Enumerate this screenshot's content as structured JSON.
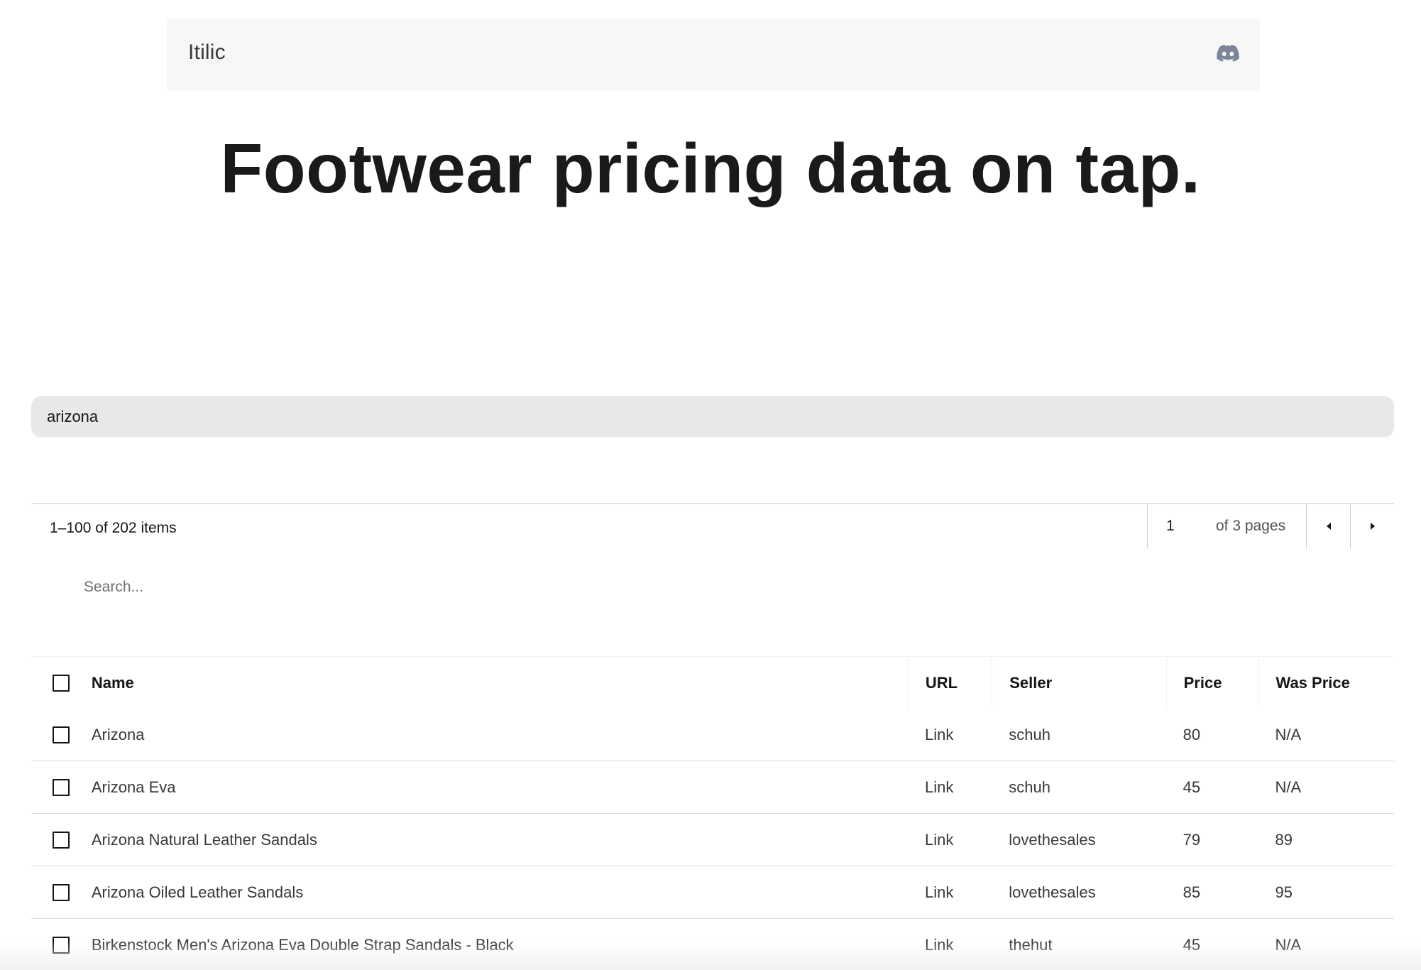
{
  "header": {
    "brand": "Itilic",
    "discord_icon": "discord-icon"
  },
  "hero": {
    "title": "Footwear pricing data on tap."
  },
  "main_search": {
    "value": "arizona"
  },
  "pagination": {
    "items_label": "1–100 of 202 items",
    "current_page": "1",
    "of_pages": "of 3 pages",
    "prev_icon": "caret-left-icon",
    "next_icon": "caret-right-icon"
  },
  "table_search": {
    "placeholder": "Search..."
  },
  "table": {
    "headers": {
      "name": "Name",
      "url": "URL",
      "seller": "Seller",
      "price": "Price",
      "was_price": "Was Price"
    },
    "rows": [
      {
        "name": "Arizona",
        "url": "Link",
        "seller": "schuh",
        "price": "80",
        "was_price": "N/A"
      },
      {
        "name": "Arizona Eva",
        "url": "Link",
        "seller": "schuh",
        "price": "45",
        "was_price": "N/A"
      },
      {
        "name": "Arizona Natural Leather Sandals",
        "url": "Link",
        "seller": "lovethesales",
        "price": "79",
        "was_price": "89"
      },
      {
        "name": "Arizona Oiled Leather Sandals",
        "url": "Link",
        "seller": "lovethesales",
        "price": "85",
        "was_price": "95"
      },
      {
        "name": "Birkenstock Men's Arizona Eva Double Strap Sandals - Black",
        "url": "Link",
        "seller": "thehut",
        "price": "45",
        "was_price": "N/A"
      }
    ]
  },
  "colors": {
    "header_bg": "#f7f7f7",
    "search_bg": "#e8e8e8",
    "discord_icon": "#7a8599"
  }
}
